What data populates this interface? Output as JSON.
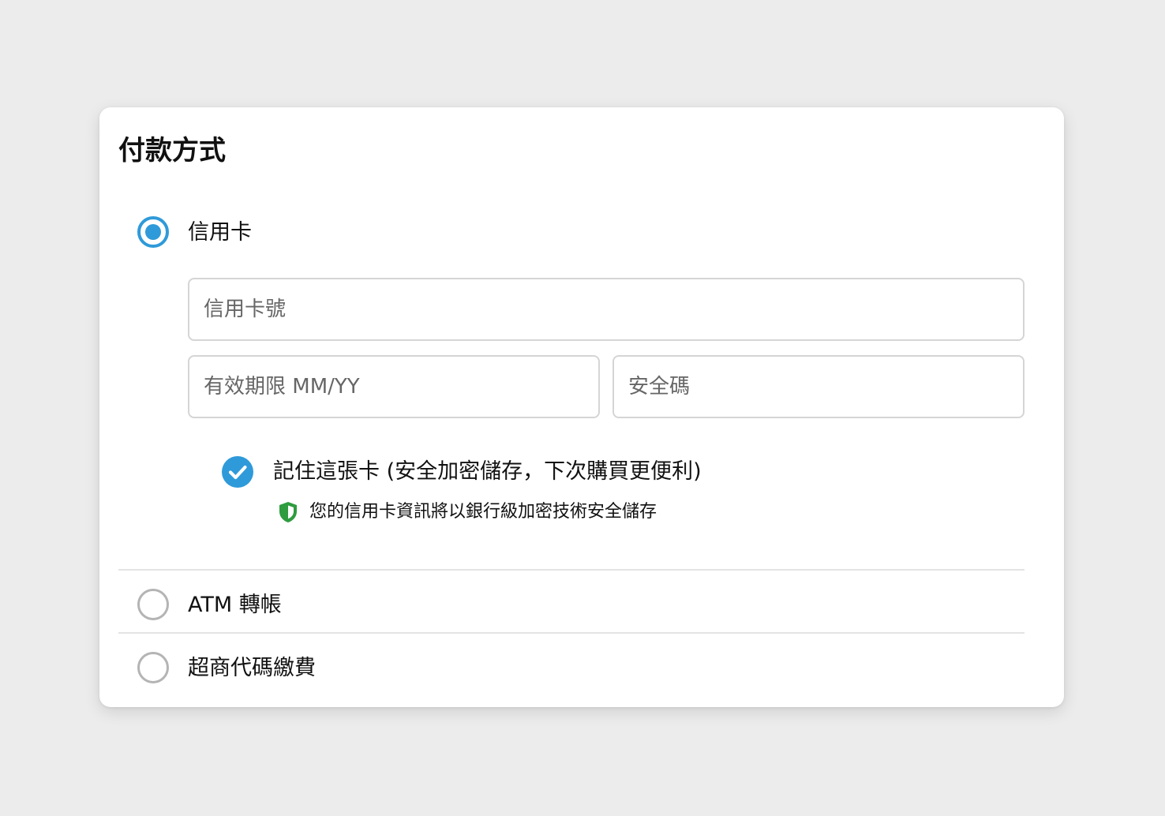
{
  "payment": {
    "title": "付款方式",
    "options": [
      {
        "label": "信用卡",
        "selected": true
      },
      {
        "label": "ATM 轉帳",
        "selected": false
      },
      {
        "label": "超商代碼繳費",
        "selected": false
      }
    ],
    "card_form": {
      "card_number_placeholder": "信用卡號",
      "card_number_value": "",
      "expiry_placeholder": "有效期限 MM/YY",
      "expiry_value": "",
      "cvc_placeholder": "安全碼",
      "cvc_value": "",
      "remember_label": "記住這張卡 (安全加密儲存，下次購買更便利)",
      "remember_checked": true,
      "secure_note": "您的信用卡資訊將以銀行級加密技術安全儲存"
    }
  },
  "icons": {
    "check": "check-icon",
    "shield": "shield-icon"
  },
  "colors": {
    "accent": "#2f9ad9",
    "shield_green": "#2e9c3f",
    "radio_off": "#b4b4b4",
    "background": "#ececec"
  }
}
